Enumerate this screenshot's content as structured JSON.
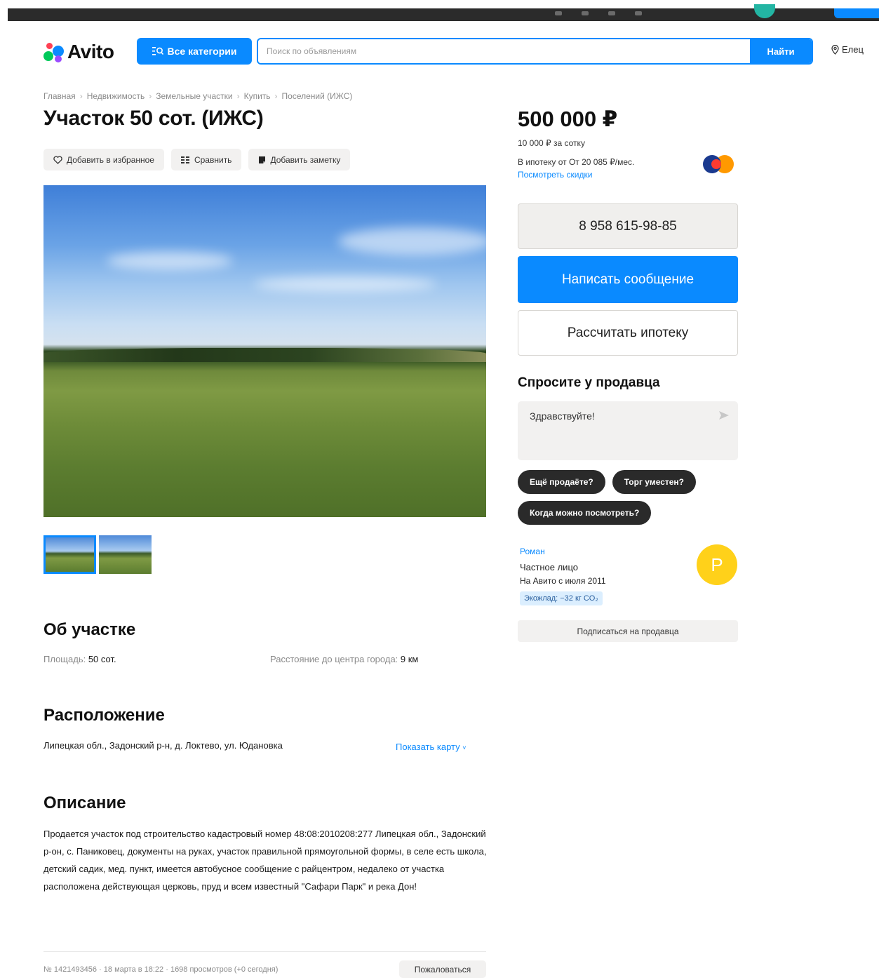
{
  "header": {
    "logo_text": "Avito",
    "categories_label": "Все категории",
    "search_placeholder": "Поиск по объявлениям",
    "search_button": "Найти",
    "city": "Елец"
  },
  "breadcrumb": [
    "Главная",
    "Недвижимость",
    "Земельные участки",
    "Купить",
    "Поселений (ИЖС)"
  ],
  "listing": {
    "title": "Участок 50 сот. (ИЖС)",
    "actions": {
      "favorite": "Добавить в избранное",
      "compare": "Сравнить",
      "note": "Добавить заметку"
    }
  },
  "about": {
    "heading": "Об участке",
    "area_label": "Площадь:",
    "area_value": "50 сот.",
    "distance_label": "Расстояние до центра города:",
    "distance_value": "9 км"
  },
  "location": {
    "heading": "Расположение",
    "address": "Липецкая обл., Задонский р-н, д. Локтево, ул. Юдановка",
    "show_map": "Показать карту"
  },
  "description": {
    "heading": "Описание",
    "text": "Продается участок под строительство кадастровый номер 48:08:2010208:277 Липецкая обл., Задонский р-он, с. Паниковец, документы на руках, участок правильной прямоугольной формы, в селе есть школа, детский садик, мед. пункт, имеется автобусное сообщение с райцентром, недалеко от участка расположена действующая церковь, пруд и всем известный \"Сафари Парк\" и река Дон!"
  },
  "footer": {
    "meta": "№ 1421493456 · 18 марта в 18:22 · 1698 просмотров (+0 сегодня)",
    "complain": "Пожаловаться"
  },
  "sidebar": {
    "price": "500 000 ₽",
    "price_per": "10 000 ₽ за сотку",
    "mortgage": "В ипотеку от От 20 085 ₽/мес.",
    "discounts": "Посмотреть скидки",
    "phone": "8 958 615-98-85",
    "message_button": "Написать сообщение",
    "mortgage_button": "Рассчитать ипотеку",
    "ask_title": "Спросите у продавца",
    "ask_default": "Здравствуйте!",
    "quick_questions": [
      "Ещё продаёте?",
      "Торг уместен?",
      "Когда можно посмотреть?"
    ],
    "seller": {
      "name": "Роман",
      "type": "Частное лицо",
      "since": "На Авито с июля 2011",
      "eco": "Экожлад: −32 кг CO₂",
      "avatar_letter": "Р"
    },
    "subscribe": "Подписаться на продавца"
  },
  "colors": {
    "accent": "#0a8aff",
    "dark_chip": "#2a2a2a",
    "avatar": "#ffd11a"
  }
}
